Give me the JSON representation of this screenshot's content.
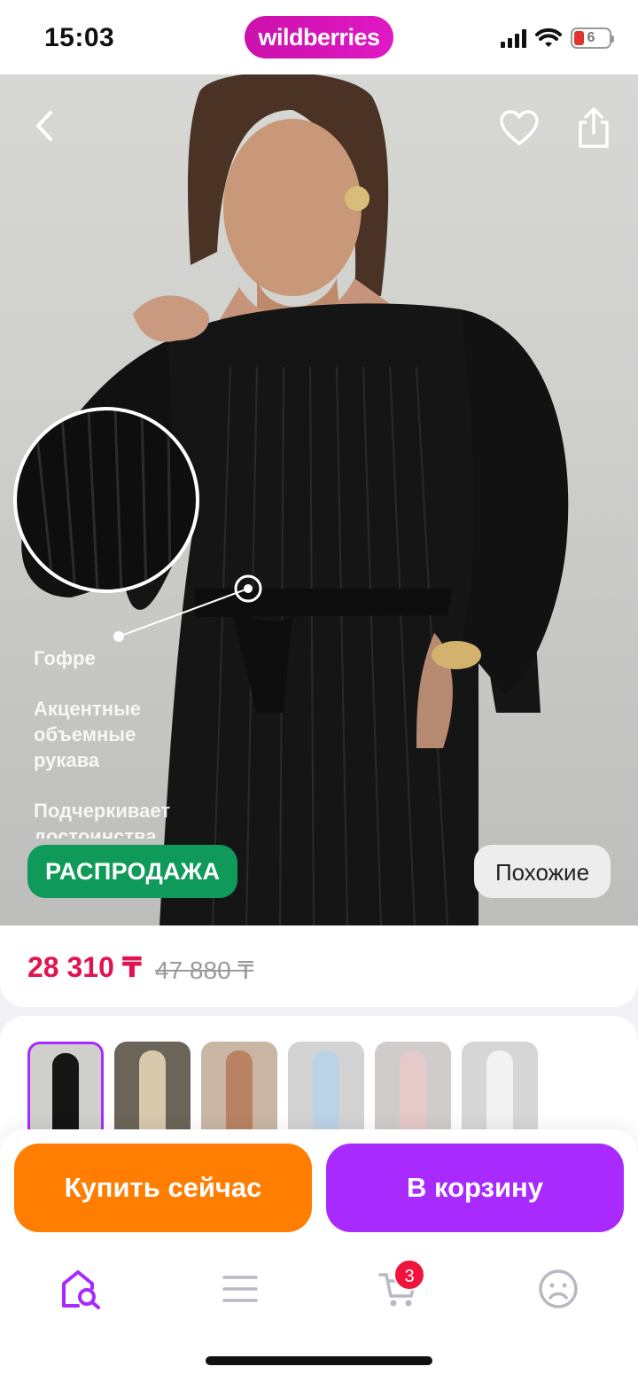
{
  "status_bar": {
    "time": "15:03",
    "brand": "wildberries",
    "battery_level": "6"
  },
  "product": {
    "features": [
      "Гофре",
      "Акцентные объемные рукава",
      "Подчеркивает достоинства."
    ],
    "sale_badge": "РАСПРОДАЖА",
    "similar_button": "Похожие",
    "price_current": "28 310 ₸",
    "price_old": "47 880 ₸"
  },
  "gallery": {
    "thumbnails": [
      {
        "bg": "#cfcfcc",
        "dress": "#151515",
        "active": true
      },
      {
        "bg": "#6b6458",
        "dress": "#d8c9ad",
        "active": false
      },
      {
        "bg": "#c9b6a4",
        "dress": "#b98363",
        "active": false
      },
      {
        "bg": "#d3d3d3",
        "dress": "#bcd3e6",
        "active": false
      },
      {
        "bg": "#d1cccc",
        "dress": "#e6c9c9",
        "active": false
      },
      {
        "bg": "#d6d6d6",
        "dress": "#f2f2f2",
        "active": false
      }
    ]
  },
  "actions": {
    "buy_now": "Купить сейчас",
    "add_to_cart": "В корзину"
  },
  "tab_bar": {
    "cart_count": "3",
    "active_tab": "home",
    "accent_color": "#a82aff"
  },
  "icons": [
    "back-arrow-icon",
    "heart-icon",
    "share-icon",
    "home-search-icon",
    "menu-icon",
    "cart-icon",
    "profile-icon"
  ]
}
